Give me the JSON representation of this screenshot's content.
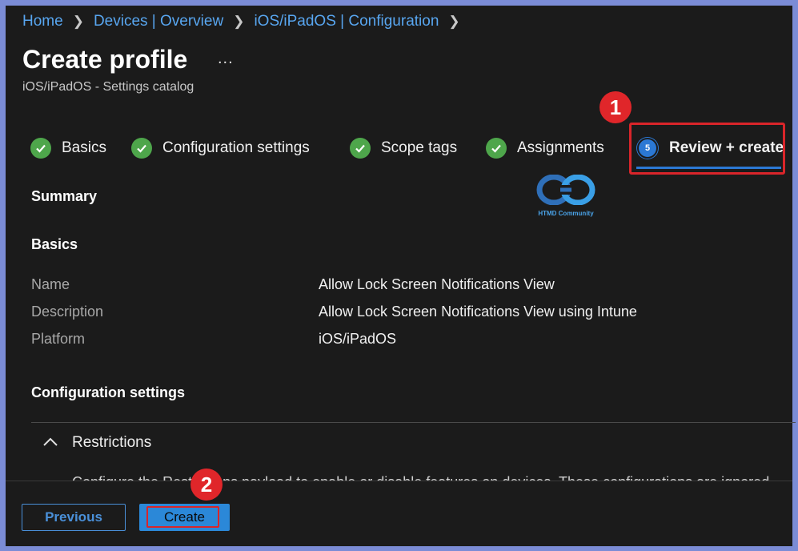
{
  "breadcrumb": [
    "Home",
    "Devices | Overview",
    "iOS/iPadOS | Configuration"
  ],
  "page": {
    "title": "Create profile",
    "more": "...",
    "subtitle": "iOS/iPadOS - Settings catalog"
  },
  "callouts": [
    "1",
    "2"
  ],
  "tabs": [
    {
      "label": "Basics",
      "state": "complete"
    },
    {
      "label": "Configuration settings",
      "state": "complete"
    },
    {
      "label": "Scope tags",
      "state": "complete"
    },
    {
      "label": "Assignments",
      "state": "complete"
    },
    {
      "label": "Review + create",
      "state": "active",
      "step": "5"
    }
  ],
  "watermark": {
    "text": "HTMD Community",
    "monogram": "HTMD"
  },
  "summary": {
    "heading": "Summary",
    "basics_heading": "Basics",
    "rows": [
      {
        "label": "Name",
        "value": "Allow Lock Screen Notifications View"
      },
      {
        "label": "Description",
        "value": "Allow Lock Screen Notifications View using Intune"
      },
      {
        "label": "Platform",
        "value": "iOS/iPadOS"
      }
    ],
    "config_heading": "Configuration settings",
    "restrictions_label": "Restrictions",
    "restrictions_desc": "Configure the Restrictions payload to enable or disable features on devices. These configurations are ignored"
  },
  "footer": {
    "previous_label": "Previous",
    "create_label": "Create"
  },
  "colors": {
    "accent": "#2b88d8",
    "link": "#58a6f0",
    "success": "#4ea64b",
    "callout": "#e0262a",
    "frame": "#7b8cd6"
  }
}
